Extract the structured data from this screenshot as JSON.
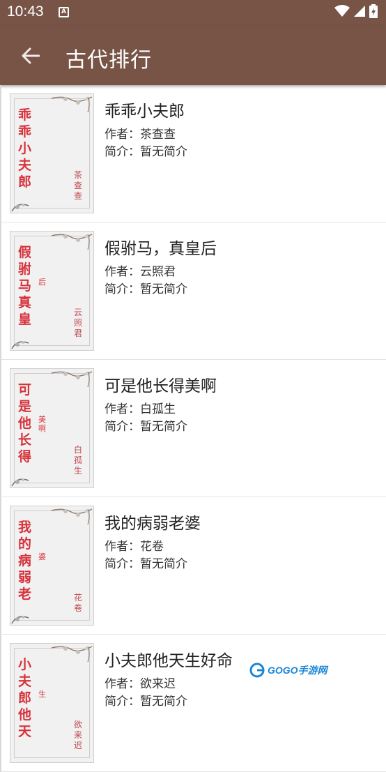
{
  "status_bar": {
    "time": "10:43",
    "a_badge": "A"
  },
  "app_bar": {
    "title": "古代排行"
  },
  "books": [
    {
      "title": "乖乖小夫郎",
      "author": "作者：茶查查",
      "intro": "简介：暂无简介",
      "cover_title": "乖乖小夫郎",
      "cover_sub": "",
      "cover_author": "茶查查"
    },
    {
      "title": "假驸马，真皇后",
      "author": "作者：云照君",
      "intro": "简介：暂无简介",
      "cover_title": "假驸马真皇",
      "cover_sub": "后",
      "cover_author": "云照君"
    },
    {
      "title": "可是他长得美啊",
      "author": "作者：白孤生",
      "intro": "简介：暂无简介",
      "cover_title": "可是他长得",
      "cover_sub": "美啊",
      "cover_author": "白孤生"
    },
    {
      "title": "我的病弱老婆",
      "author": "作者：花卷",
      "intro": "简介：暂无简介",
      "cover_title": "我的病弱老",
      "cover_sub": "婆",
      "cover_author": "花卷"
    },
    {
      "title": "小夫郎他天生好命",
      "author": "作者：欲来迟",
      "intro": "简介：暂无简介",
      "cover_title": "小夫郎他天",
      "cover_sub": "生",
      "cover_author": "欲来迟"
    }
  ],
  "watermark": {
    "text": "GOGO手游网"
  },
  "colors": {
    "app_bar": "#785447",
    "cover_text": "#d7323b"
  }
}
